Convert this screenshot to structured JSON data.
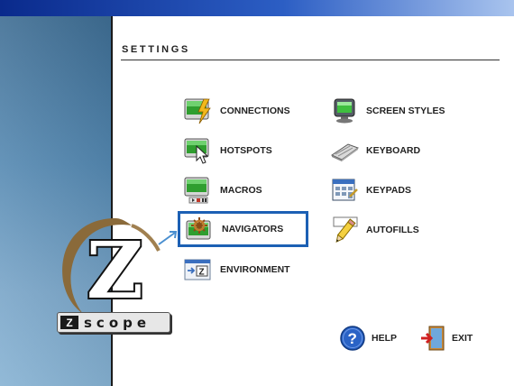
{
  "page": {
    "title": "SETTINGS"
  },
  "menu": {
    "left": [
      {
        "label": "CONNECTIONS",
        "icon": "connections-icon"
      },
      {
        "label": "HOTSPOTS",
        "icon": "hotspots-icon"
      },
      {
        "label": "MACROS",
        "icon": "macros-icon"
      },
      {
        "label": "NAVIGATORS",
        "icon": "navigators-icon",
        "selected": true
      },
      {
        "label": "ENVIRONMENT",
        "icon": "environment-icon"
      }
    ],
    "right": [
      {
        "label": "SCREEN STYLES",
        "icon": "screen-styles-icon"
      },
      {
        "label": "KEYBOARD",
        "icon": "keyboard-icon"
      },
      {
        "label": "KEYPADS",
        "icon": "keypads-icon"
      },
      {
        "label": "AUTOFILLS",
        "icon": "autofills-icon"
      }
    ]
  },
  "buttons": {
    "help": "HELP",
    "exit": "EXIT"
  },
  "logo": {
    "letter": "Z",
    "badge_letter": "Z",
    "badge_text": "scope"
  },
  "colors": {
    "selection_border": "#1c60b4",
    "sidebar": "#5488b1",
    "titlebar": "#0a2a8c"
  }
}
